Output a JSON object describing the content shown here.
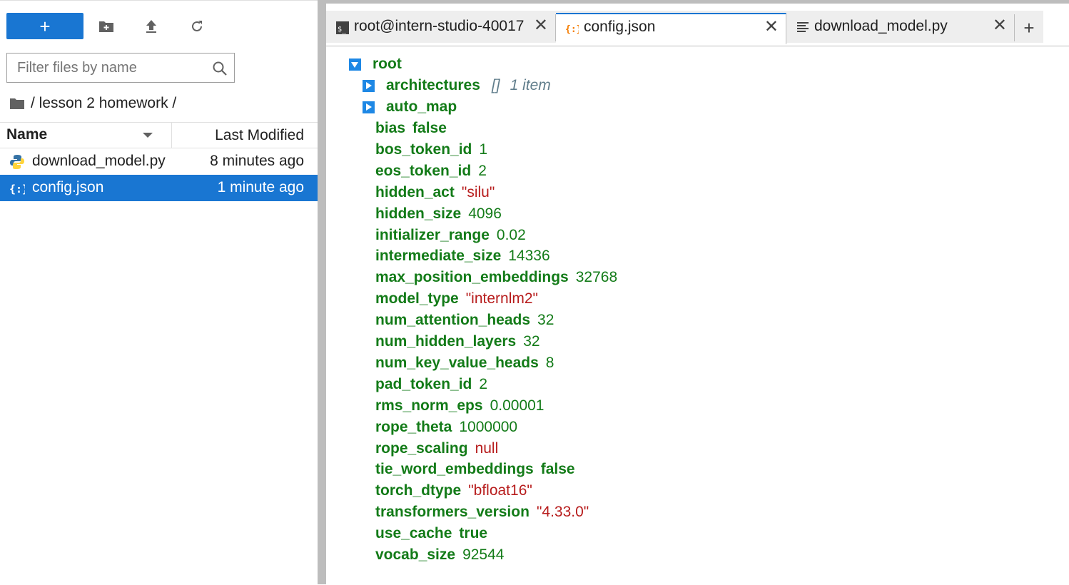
{
  "file_browser": {
    "new_button_label": "+",
    "filter_placeholder": "Filter files by name",
    "breadcrumb": "/ lesson 2 homework /",
    "columns": {
      "name": "Name",
      "modified": "Last Modified"
    },
    "files": [
      {
        "name": "download_model.py",
        "modified": "8 minutes ago",
        "icon": "python-icon",
        "selected": false
      },
      {
        "name": "config.json",
        "modified": "1 minute ago",
        "icon": "json-icon",
        "selected": true
      }
    ]
  },
  "tabs": [
    {
      "label": "root@intern-studio-40017",
      "icon": "terminal-icon",
      "close": "✕",
      "active": false
    },
    {
      "label": "config.json",
      "icon": "json-icon",
      "close": "✕",
      "active": true
    },
    {
      "label": "download_model.py",
      "icon": "text-file-icon",
      "close": "✕",
      "active": false
    }
  ],
  "add_tab_label": "+",
  "json_tree": {
    "root_label": "root",
    "collapsed": [
      {
        "key": "architectures",
        "meta_bracket": "[]",
        "meta_count": "1 item"
      },
      {
        "key": "auto_map",
        "meta_bracket": "",
        "meta_count": ""
      }
    ],
    "entries": [
      {
        "key": "bias",
        "value": "false",
        "type": "bool"
      },
      {
        "key": "bos_token_id",
        "value": "1",
        "type": "num"
      },
      {
        "key": "eos_token_id",
        "value": "2",
        "type": "num"
      },
      {
        "key": "hidden_act",
        "value": "\"silu\"",
        "type": "str"
      },
      {
        "key": "hidden_size",
        "value": "4096",
        "type": "num"
      },
      {
        "key": "initializer_range",
        "value": "0.02",
        "type": "num"
      },
      {
        "key": "intermediate_size",
        "value": "14336",
        "type": "num"
      },
      {
        "key": "max_position_embeddings",
        "value": "32768",
        "type": "num"
      },
      {
        "key": "model_type",
        "value": "\"internlm2\"",
        "type": "str"
      },
      {
        "key": "num_attention_heads",
        "value": "32",
        "type": "num"
      },
      {
        "key": "num_hidden_layers",
        "value": "32",
        "type": "num"
      },
      {
        "key": "num_key_value_heads",
        "value": "8",
        "type": "num"
      },
      {
        "key": "pad_token_id",
        "value": "2",
        "type": "num"
      },
      {
        "key": "rms_norm_eps",
        "value": "0.00001",
        "type": "num"
      },
      {
        "key": "rope_theta",
        "value": "1000000",
        "type": "num"
      },
      {
        "key": "rope_scaling",
        "value": "null",
        "type": "null"
      },
      {
        "key": "tie_word_embeddings",
        "value": "false",
        "type": "bool"
      },
      {
        "key": "torch_dtype",
        "value": "\"bfloat16\"",
        "type": "str"
      },
      {
        "key": "transformers_version",
        "value": "\"4.33.0\"",
        "type": "str"
      },
      {
        "key": "use_cache",
        "value": "true",
        "type": "bool"
      },
      {
        "key": "vocab_size",
        "value": "92544",
        "type": "num"
      }
    ]
  },
  "colors": {
    "accent": "#1976d2",
    "json_key": "#137b18",
    "json_string": "#b71c1c",
    "toggle": "#1e88e5"
  }
}
